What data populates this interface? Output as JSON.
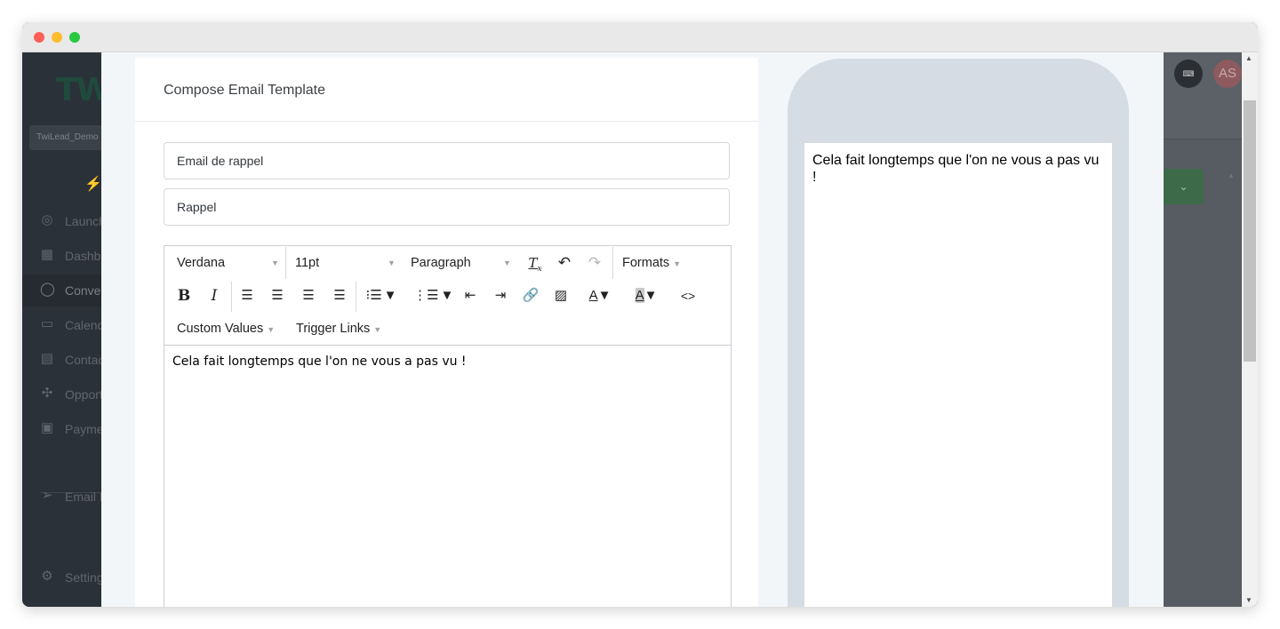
{
  "sidebar": {
    "logo": "TW",
    "account": "TwiLead_Demo",
    "items": [
      {
        "label": "Launchpad",
        "icon": "rocket-icon"
      },
      {
        "label": "Dashboard",
        "icon": "dashboard-icon"
      },
      {
        "label": "Conversations",
        "icon": "chat-icon"
      },
      {
        "label": "Calendars",
        "icon": "calendar-icon"
      },
      {
        "label": "Contacts",
        "icon": "contacts-icon"
      },
      {
        "label": "Opportunities",
        "icon": "opportunities-icon"
      },
      {
        "label": "Payments",
        "icon": "payments-icon"
      },
      {
        "label": "Email Marketing",
        "icon": "send-icon"
      },
      {
        "label": "Settings",
        "icon": "settings-icon"
      }
    ]
  },
  "header": {
    "avatar_initials": "AS"
  },
  "modal": {
    "title": "Compose Email Template",
    "template_name": "Email de rappel",
    "subject": "Rappel",
    "toolbar": {
      "font_family": "Verdana",
      "font_size": "11pt",
      "block_format": "Paragraph",
      "formats": "Formats",
      "custom_values": "Custom Values",
      "trigger_links": "Trigger Links",
      "code": "<>"
    },
    "body_text": "Cela fait longtemps que l'on ne vous a pas vu !",
    "preview_text": "Cela fait longtemps que l'on ne vous a pas vu !"
  },
  "colors": {
    "accent_green": "#3d6b4a",
    "sidebar_bg": "#2b3138",
    "modal_bg": "#f3f6f9",
    "phone_frame": "#d5dce3"
  }
}
